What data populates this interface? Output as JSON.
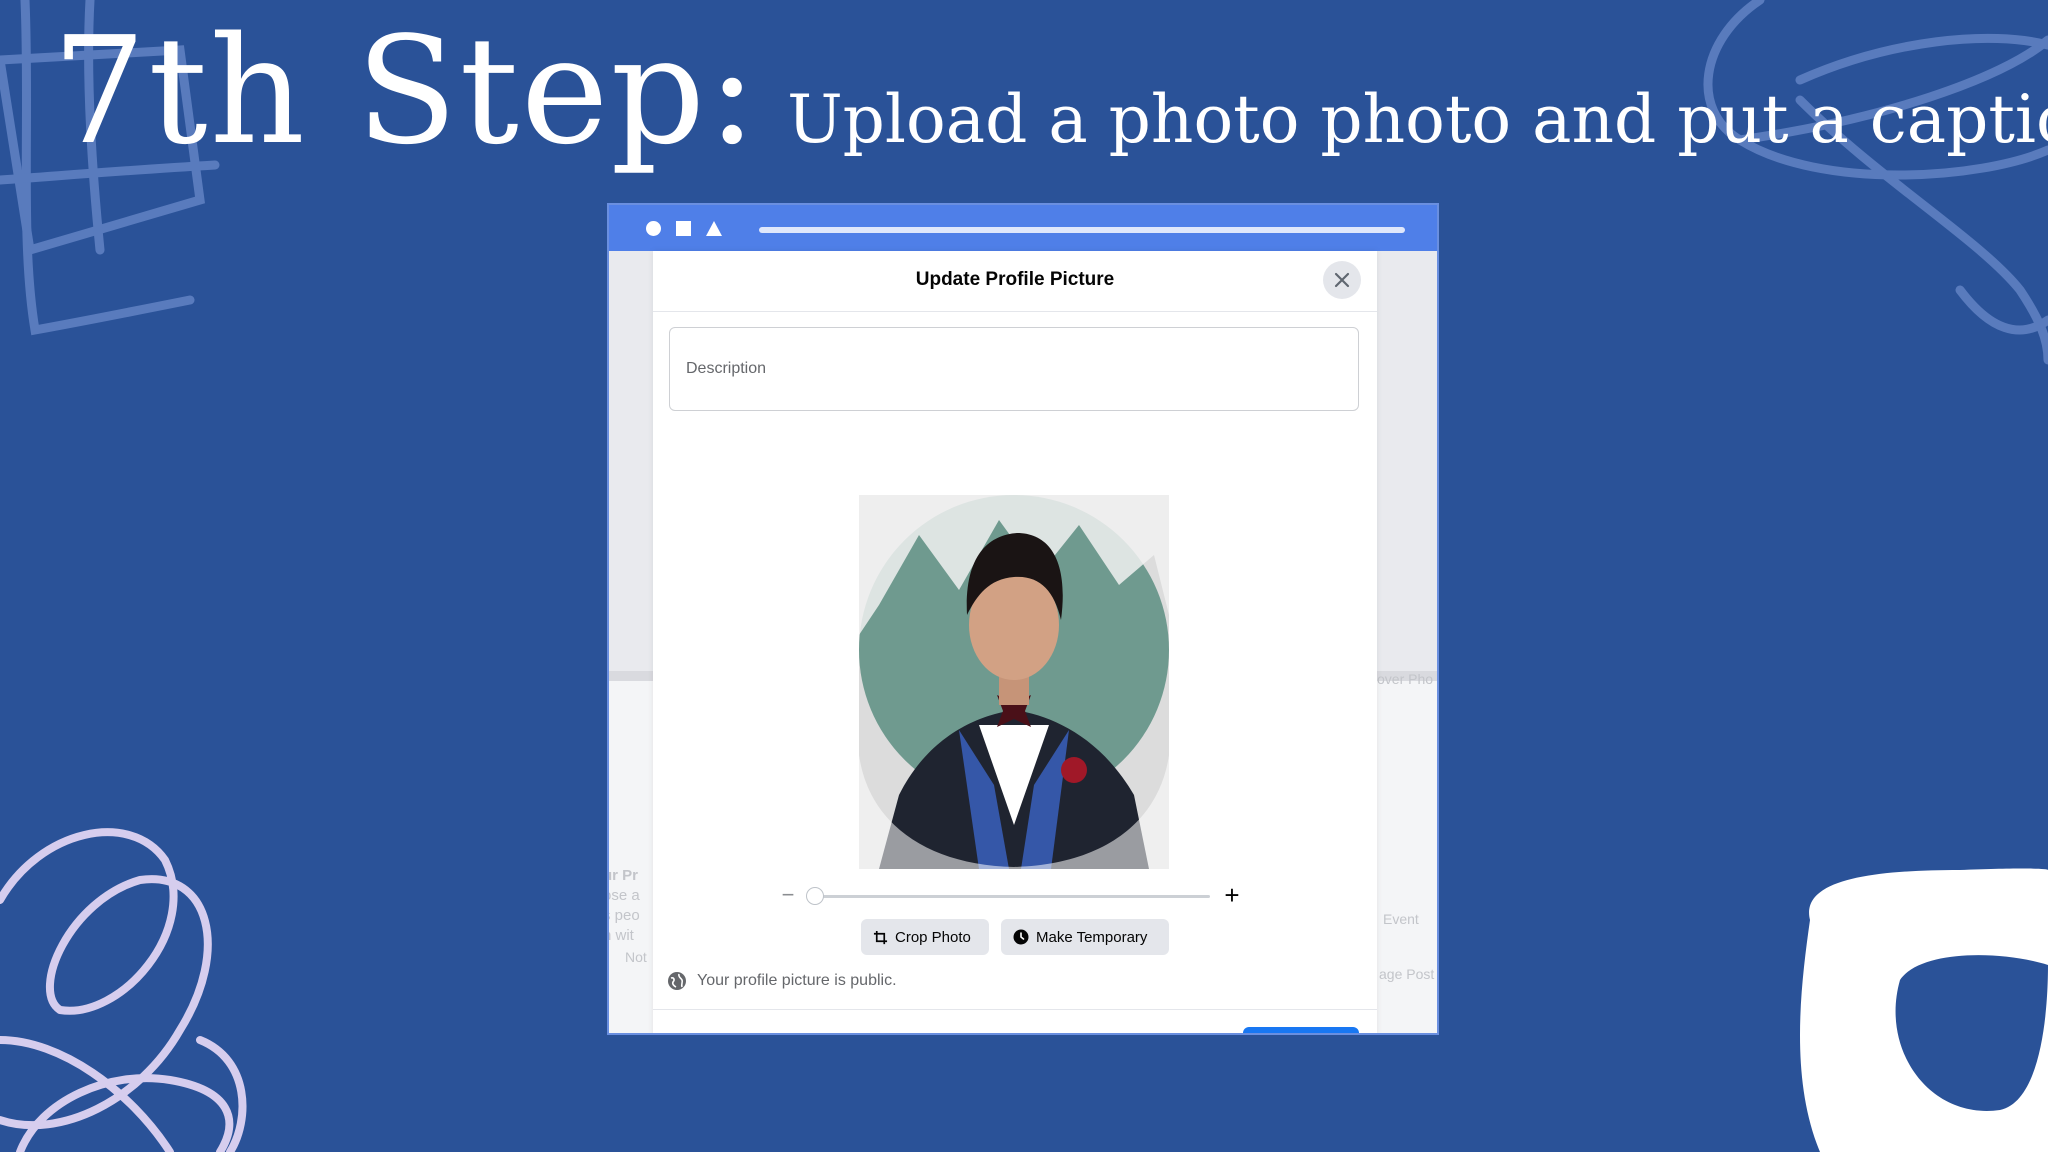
{
  "slide": {
    "step_label": "7th Step:",
    "step_caption": "Upload a photo photo and put a caption"
  },
  "browser": {
    "background_texts": {
      "cover_photo": "over Pho",
      "event": "Event",
      "page_post": "age Post",
      "left_heading": "ur Pr",
      "left_line1": "ose a",
      "left_line2": "s peo",
      "left_line3": "h wit",
      "left_not": "Not"
    }
  },
  "dialog": {
    "title": "Update Profile Picture",
    "description_placeholder": "Description",
    "crop_label": "Crop Photo",
    "temporary_label": "Make Temporary",
    "privacy_text": "Your profile picture is public.",
    "zoom_level": 0.0
  },
  "colors": {
    "slide_background": "#2a5298",
    "browser_bar": "#4f7fe8",
    "facebook_blue": "#1877f2"
  }
}
